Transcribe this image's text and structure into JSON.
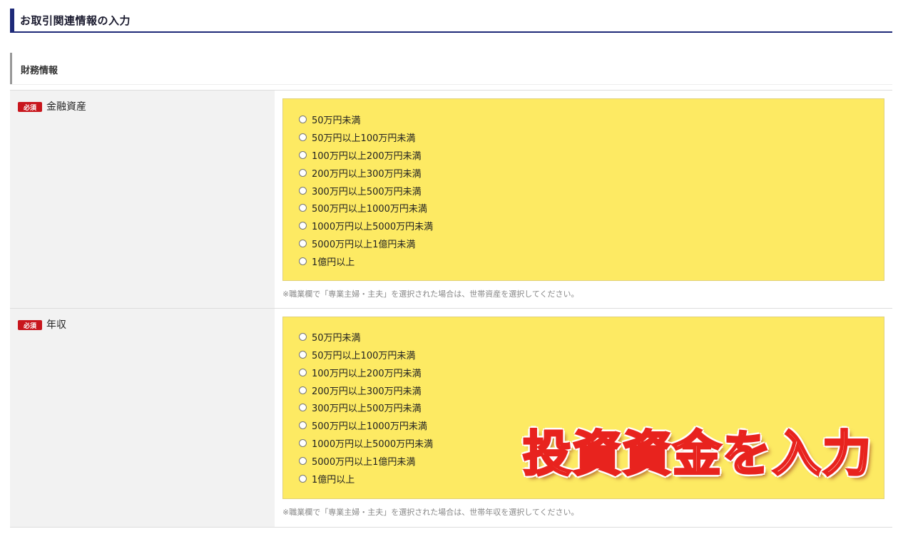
{
  "header": {
    "title": "お取引関連情報の入力"
  },
  "section": {
    "title": "財務情報"
  },
  "fields": [
    {
      "badge": "必須",
      "label": "金融資産",
      "options": [
        "50万円未満",
        "50万円以上100万円未満",
        "100万円以上200万円未満",
        "200万円以上300万円未満",
        "300万円以上500万円未満",
        "500万円以上1000万円未満",
        "1000万円以上5000万円未満",
        "5000万円以上1億円未満",
        "1億円以上"
      ],
      "note": "※職業欄で「専業主婦・主夫」を選択された場合は、世帯資産を選択してください。"
    },
    {
      "badge": "必須",
      "label": "年収",
      "options": [
        "50万円未満",
        "50万円以上100万円未満",
        "100万円以上200万円未満",
        "200万円以上300万円未満",
        "300万円以上500万円未満",
        "500万円以上1000万円未満",
        "1000万円以上5000万円未満",
        "5000万円以上1億円未満",
        "1億円以上"
      ],
      "note": "※職業欄で「専業主婦・主夫」を選択された場合は、世帯年収を選択してください。"
    }
  ],
  "overlay": {
    "text": "投資資金を入力"
  },
  "colors": {
    "accent": "#1e2a78",
    "badge": "#c8161d",
    "highlight": "#fdea63",
    "overlay_stroke": "#e8231e"
  }
}
